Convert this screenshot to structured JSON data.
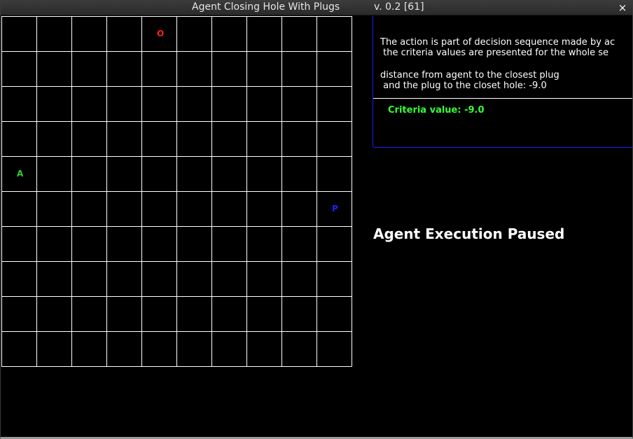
{
  "window": {
    "title": "Agent Closing Hole With Plugs",
    "version": "v. 0.2 [61]",
    "close_glyph": "×"
  },
  "grid": {
    "rows": 10,
    "cols": 10,
    "line_color": "#ffffff",
    "markers": [
      {
        "label": "O",
        "row": 0,
        "col": 4,
        "color": "#ff2020",
        "meaning": "hole"
      },
      {
        "label": "A",
        "row": 4,
        "col": 0,
        "color": "#33cc33",
        "meaning": "agent"
      },
      {
        "label": "P",
        "row": 5,
        "col": 9,
        "color": "#2020ff",
        "meaning": "plug"
      }
    ]
  },
  "info": {
    "line1": "The action is part of decision sequence made by ac",
    "line2": " the criteria values are presented for the whole se",
    "line3": "distance from agent to the closest plug",
    "line4": " and the plug to the closet hole: -9.0",
    "criteria": "Criteria value: -9.0",
    "border_color": "#1a1aff",
    "criteria_color": "#33ff33"
  },
  "status": {
    "paused_text": "Agent Execution Paused"
  }
}
